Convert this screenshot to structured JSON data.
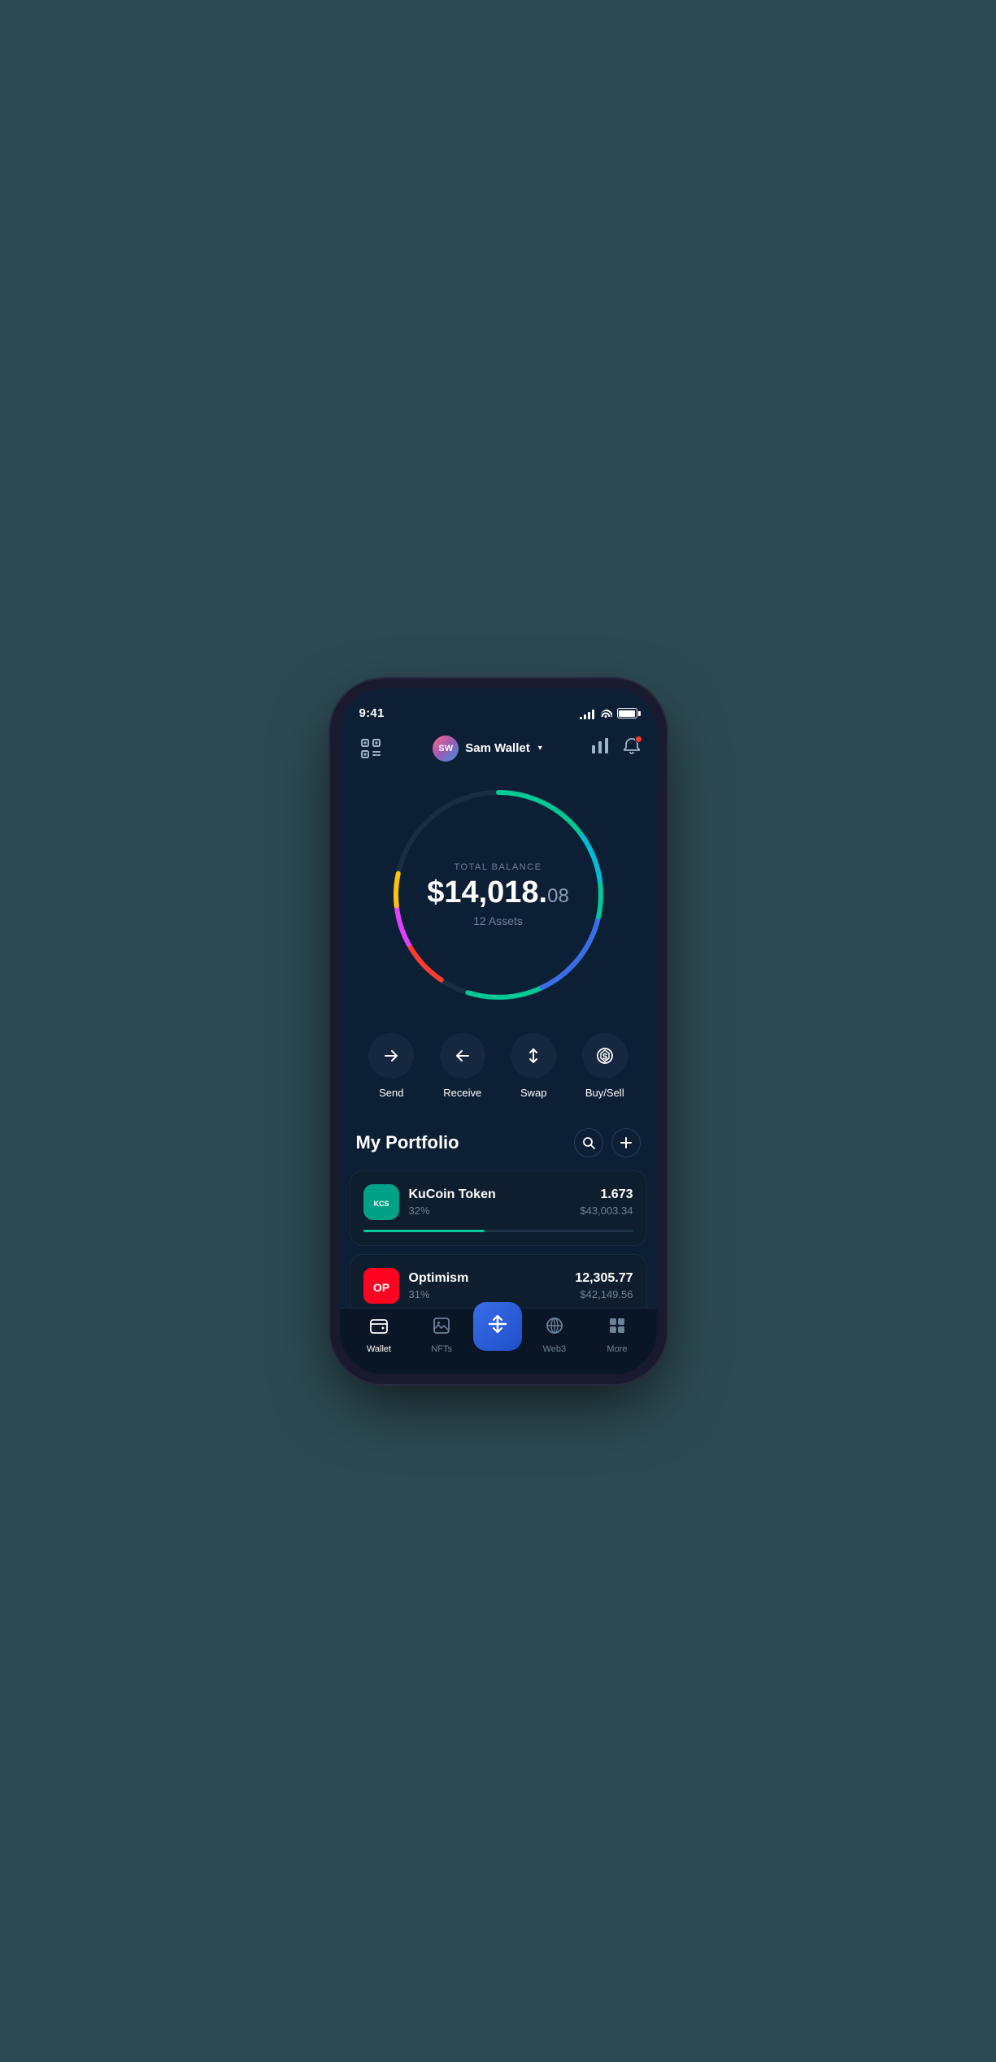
{
  "status": {
    "time": "9:41",
    "signal_bars": [
      3,
      6,
      9,
      12
    ],
    "battery_label": "battery"
  },
  "header": {
    "scan_label": "scan",
    "avatar_initials": "SW",
    "wallet_name": "Sam Wallet",
    "chart_label": "chart",
    "bell_label": "notifications"
  },
  "balance": {
    "label": "TOTAL BALANCE",
    "whole": "$14,018.",
    "cents": "08",
    "assets_count": "12 Assets"
  },
  "actions": [
    {
      "id": "send",
      "label": "Send",
      "icon": "→"
    },
    {
      "id": "receive",
      "label": "Receive",
      "icon": "←"
    },
    {
      "id": "swap",
      "label": "Swap",
      "icon": "⇅"
    },
    {
      "id": "buysell",
      "label": "Buy/Sell",
      "icon": "$"
    }
  ],
  "portfolio": {
    "title": "My Portfolio",
    "search_label": "search",
    "add_label": "add"
  },
  "assets": [
    {
      "id": "kucoin",
      "name": "KuCoin Token",
      "percent": "32%",
      "amount": "1.673",
      "usd": "$43,003.34",
      "bar_width": "45",
      "bar_color": "#00c896",
      "logo_text": "KCS",
      "logo_bg": "#00a186"
    },
    {
      "id": "optimism",
      "name": "Optimism",
      "percent": "31%",
      "amount": "12,305.77",
      "usd": "$42,149.56",
      "bar_width": "42",
      "bar_color": "#ff4a57",
      "logo_text": "OP",
      "logo_bg": "#ff0420"
    }
  ],
  "bottom_nav": [
    {
      "id": "wallet",
      "label": "Wallet",
      "active": true
    },
    {
      "id": "nfts",
      "label": "NFTs",
      "active": false
    },
    {
      "id": "center",
      "label": "",
      "active": false
    },
    {
      "id": "web3",
      "label": "Web3",
      "active": false
    },
    {
      "id": "more",
      "label": "More",
      "active": false
    }
  ]
}
